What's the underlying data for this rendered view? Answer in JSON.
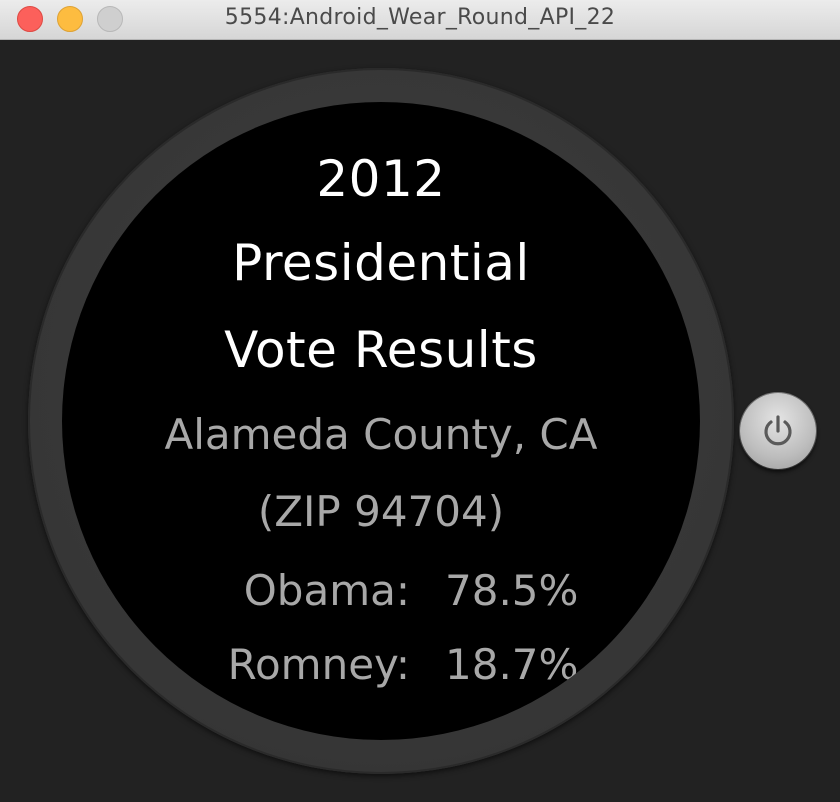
{
  "window": {
    "title": "5554:Android_Wear_Round_API_22"
  },
  "watch": {
    "title_lines": [
      "2012",
      "Presidential",
      "Vote Results"
    ],
    "location_lines": [
      "Alameda County, CA",
      "(ZIP 94704)"
    ],
    "results": [
      {
        "name": "Obama:",
        "value": "78.5%"
      },
      {
        "name": "Romney:",
        "value": "18.7%"
      }
    ],
    "pager": {
      "pages": 2,
      "active_index": 1
    }
  },
  "controls": {
    "power_icon": "power-icon"
  },
  "colors": {
    "headline": "#ffffff",
    "secondary_text": "#a8a8a8",
    "screen": "#000000",
    "bezel": "#3a3a3a"
  }
}
